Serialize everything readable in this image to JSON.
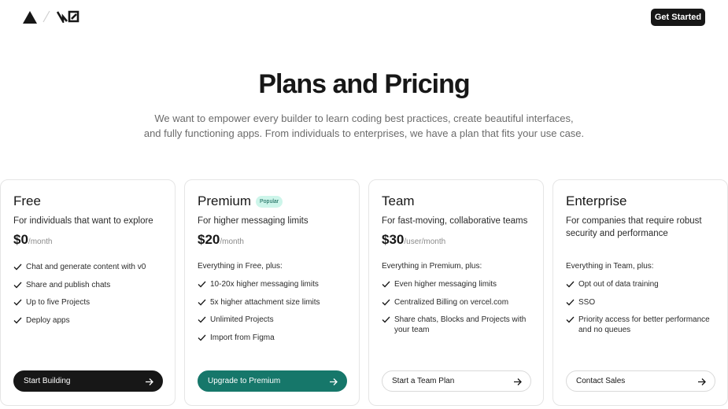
{
  "nav": {
    "logo_icon": "triangle-logo-icon",
    "brand_icon": "v0-logo-icon",
    "get_started": "Get Started"
  },
  "hero": {
    "title": "Plans and Pricing",
    "subtitle_line1": "We want to empower every builder to learn coding best practices, create beautiful interfaces,",
    "subtitle_line2": "and fully functioning apps. From individuals to enterprises, we have a plan that fits your use case."
  },
  "plans": [
    {
      "name": "Free",
      "description": "For individuals that want to explore",
      "price": "$0",
      "period": "/month",
      "includes": "",
      "features": [
        "Chat and generate content with v0",
        "Share and publish chats",
        "Up to five Projects",
        "Deploy apps"
      ],
      "cta": "Start Building"
    },
    {
      "name": "Premium",
      "badge": "Popular",
      "description": "For higher messaging limits",
      "price": "$20",
      "period": "/month",
      "includes": "Everything in Free, plus:",
      "features": [
        "10-20x higher messaging limits",
        "5x higher attachment size limits",
        "Unlimited Projects",
        "Import from Figma"
      ],
      "cta": "Upgrade to Premium"
    },
    {
      "name": "Team",
      "description": "For fast-moving, collaborative teams",
      "price": "$30",
      "period": "/user/month",
      "includes": "Everything in Premium, plus:",
      "features": [
        "Even higher messaging limits",
        "Centralized Billing on vercel.com",
        "Share chats, Blocks and Projects with your team"
      ],
      "cta": "Start a Team Plan"
    },
    {
      "name": "Enterprise",
      "description": "For companies that require robust security and performance",
      "price": "",
      "period": "",
      "includes": "Everything in Team, plus:",
      "features": [
        "Opt out of data training",
        "SSO",
        "Priority access for better performance and no queues"
      ],
      "cta": "Contact Sales"
    }
  ],
  "colors": {
    "dark": "#171717",
    "teal": "#16776a",
    "badge_bg": "#cdf5ea"
  }
}
